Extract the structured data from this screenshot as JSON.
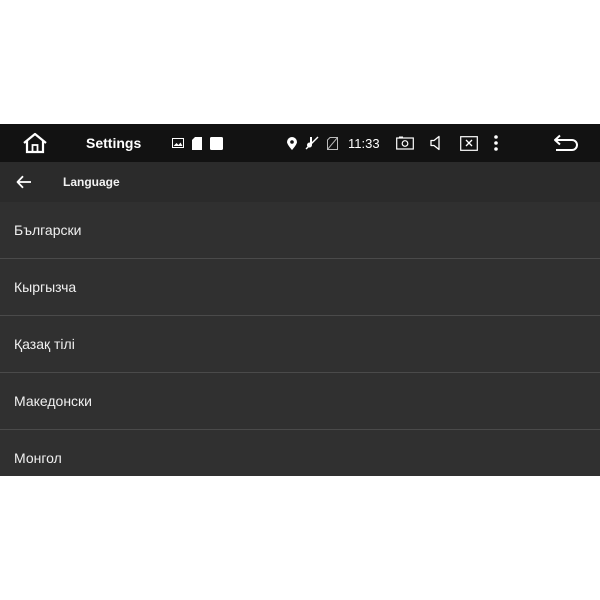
{
  "status_bar": {
    "app_title": "Settings",
    "time": "11:33",
    "icons": [
      "home-icon",
      "image-icon",
      "sd-card-icon",
      "square-icon",
      "location-icon",
      "sound-off-icon",
      "no-sim-icon",
      "screenshot-icon",
      "volume-icon",
      "close-window-icon",
      "more-vert-icon",
      "back-icon"
    ]
  },
  "toolbar": {
    "title": "Language"
  },
  "languages": [
    "Български",
    "Кыргызча",
    "Қазақ тілі",
    "Македонски",
    "Монгол"
  ],
  "colors": {
    "status_bar_bg": "#121212",
    "toolbar_bg": "#2b2b2b",
    "list_bg": "#303030",
    "divider": "#4a4a4a",
    "text": "#f0f0f0"
  }
}
